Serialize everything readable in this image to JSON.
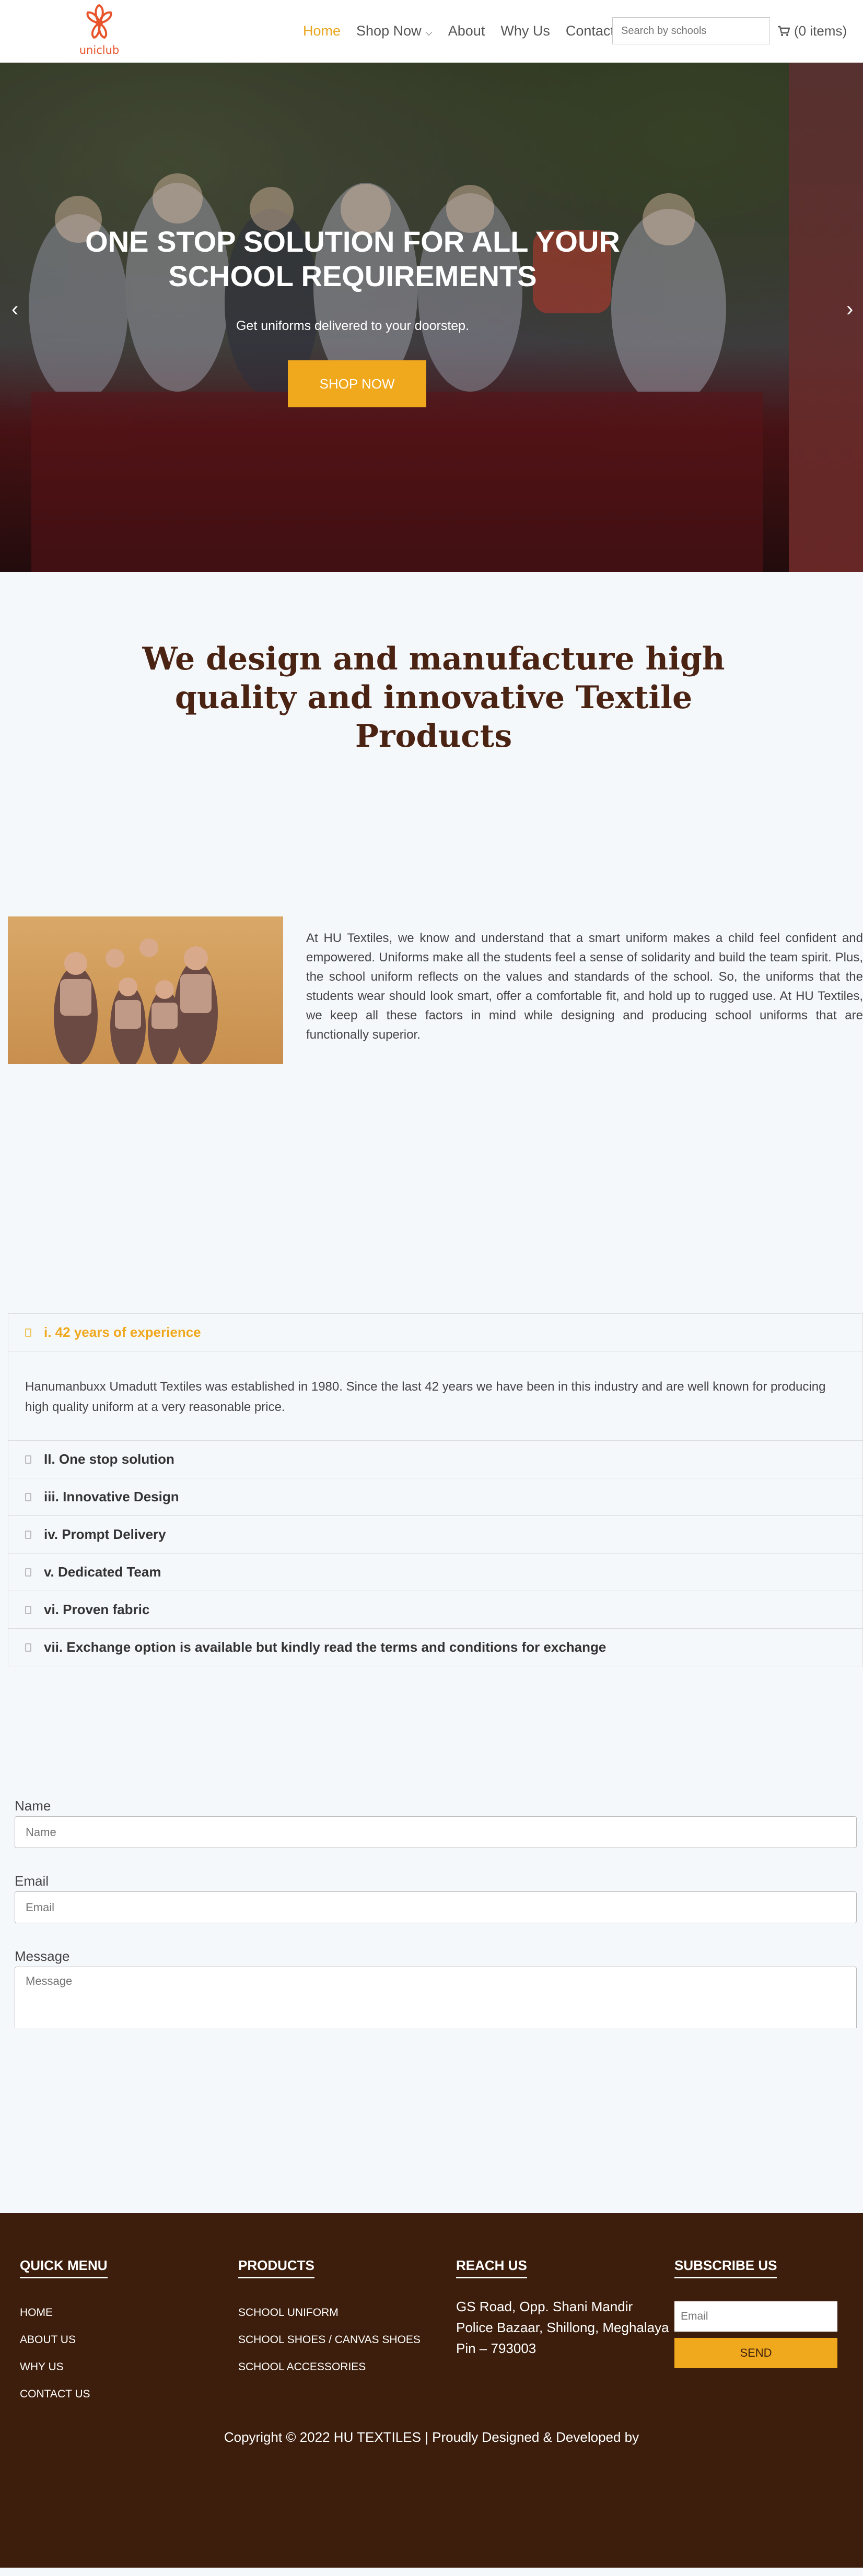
{
  "brand": {
    "logo_text": "uniclub",
    "accent": "#f0a81d",
    "logo_color": "#e8542b"
  },
  "nav": {
    "items": [
      {
        "label": "Home",
        "active": true
      },
      {
        "label": "Shop Now",
        "has_dropdown": true
      },
      {
        "label": "About"
      },
      {
        "label": "Why Us"
      },
      {
        "label": "Contact"
      }
    ],
    "search_placeholder": "Search by schools",
    "cart_label": "(0 items)",
    "cart_icon": "shopping-cart-icon"
  },
  "hero": {
    "title": "ONE STOP SOLUTION FOR ALL YOUR SCHOOL REQUIREMENTS",
    "subtitle": "Get uniforms delivered to your doorstep.",
    "cta": "SHOP NOW"
  },
  "intro": {
    "heading": "We design and manufacture high quality and innovative Textile Products"
  },
  "about": {
    "text": "At HU Textiles, we know and understand that a smart uniform makes a child feel confident and empowered. Uniforms make all the students feel a sense of solidarity and build the team spirit. Plus, the school uniform reflects on the values and standards of the school. So, the uniforms that the students wear should look smart, offer a comfortable fit, and hold up to rugged use. At HU Textiles, we keep all these factors in mind while designing and producing school uniforms that are functionally superior."
  },
  "why_us": {
    "items": [
      {
        "title": "i. 42 years of experience",
        "open": true,
        "body": "Hanumanbuxx Umadutt Textiles was established in 1980. Since the last 42 years we have been in this industry and are well known for producing high quality uniform at a very reasonable price."
      },
      {
        "title": "II. One stop solution"
      },
      {
        "title": "iii. Innovative Design"
      },
      {
        "title": "iv. Prompt Delivery"
      },
      {
        "title": "v. Dedicated Team"
      },
      {
        "title": "vi. Proven fabric"
      },
      {
        "title": "vii. Exchange option is available but kindly read the terms and conditions for exchange"
      }
    ]
  },
  "contact_form": {
    "name_label": "Name",
    "name_placeholder": "Name",
    "email_label": "Email",
    "email_placeholder": "Email",
    "message_label": "Message",
    "message_placeholder": "Message"
  },
  "footer": {
    "quick_menu": {
      "title": "QUICK MENU",
      "links": [
        "HOME",
        "ABOUT US",
        "WHY US",
        "CONTACT US"
      ]
    },
    "products": {
      "title": "PRODUCTS",
      "links": [
        "SCHOOL UNIFORM",
        "SCHOOL SHOES / CANVAS SHOES",
        "SCHOOL ACCESSORIES"
      ]
    },
    "reach_us": {
      "title": "REACH US",
      "line1": "GS Road, Opp. Shani Mandir",
      "line2": "Police Bazaar, Shillong, Meghalaya",
      "line3": "Pin – 793003"
    },
    "subscribe": {
      "title": "SUBSCRIBE US",
      "email_placeholder": "Email",
      "button": "SEND"
    },
    "copyright": "Copyright © 2022 HU TEXTILES | Proudly Designed & Developed by",
    "background": "#3d1e0c"
  }
}
